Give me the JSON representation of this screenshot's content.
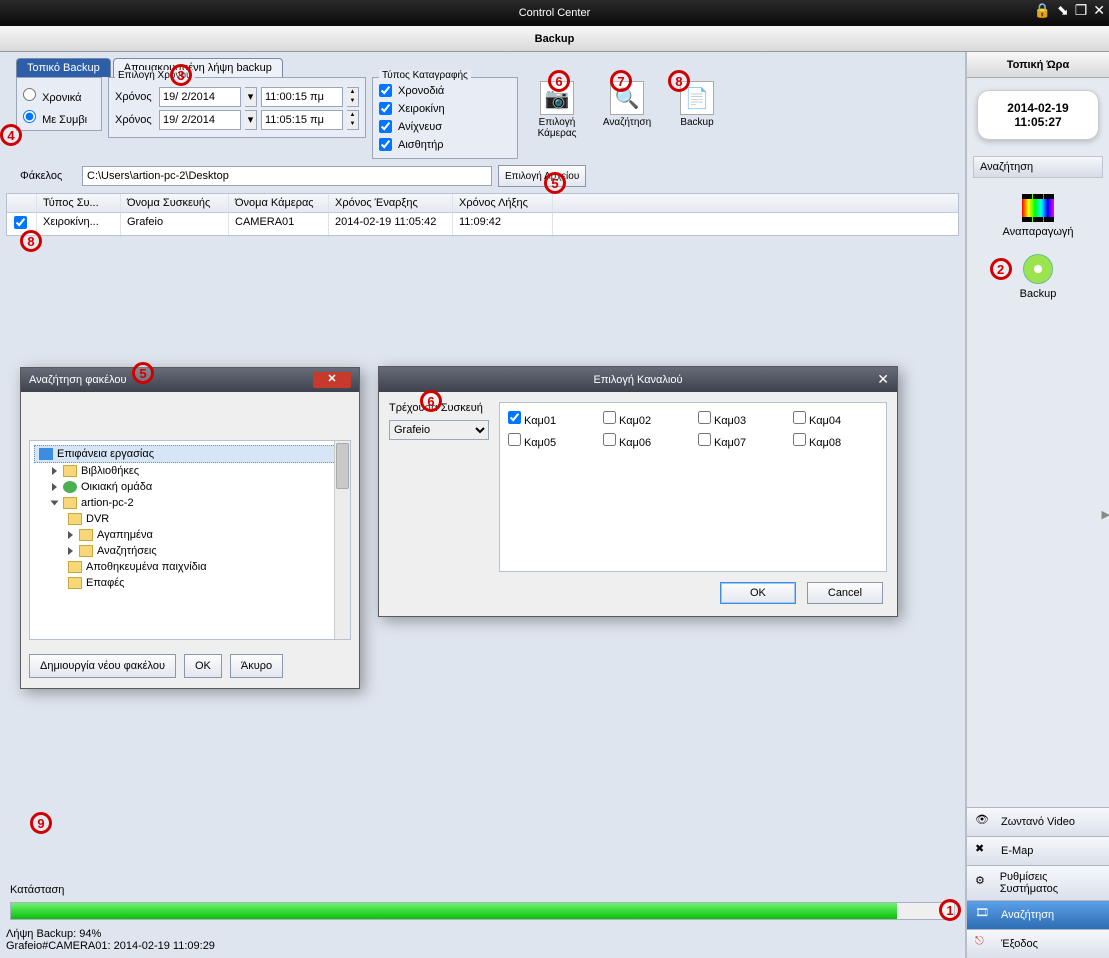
{
  "window": {
    "title": "Control Center",
    "section": "Backup"
  },
  "rightPanel": {
    "clockHeader": "Τοπική Ώρα",
    "date": "2014-02-19",
    "time": "11:05:27",
    "searchHeader": "Αναζήτηση",
    "playbackLabel": "Αναπαραγωγή",
    "backupLabel": "Backup"
  },
  "nav": {
    "live": "Ζωντανό Video",
    "emap": "E-Map",
    "settings": "Ρυθμίσεις Συστήματος",
    "search": "Αναζήτηση",
    "exit": "Έξοδος"
  },
  "tabs": {
    "local": "Τοπικό Backup",
    "remote": "Απομακρυσμένη λήψη backup"
  },
  "mode": {
    "byTime": "Χρονικά",
    "byEvent": "Με Συμβι"
  },
  "timeGroup": {
    "title": "Επιλογή Χρόνου",
    "row1Label": "Χρόνος",
    "date1": "19/ 2/2014",
    "time1": "11:00:15 πμ",
    "row2Label": "Χρόνος",
    "date2": "19/ 2/2014",
    "time2": "11:05:15 πμ"
  },
  "typeGroup": {
    "title": "Τύπος Καταγραφής",
    "c1": "Χρονοδιά",
    "c2": "Χειροκίνη",
    "c3": "Ανίχνευσ",
    "c4": "Αισθητήρ"
  },
  "bigButtons": {
    "selectCam": "Επιλογή Κάμερας",
    "search": "Αναζήτηση",
    "backup": "Backup"
  },
  "folder": {
    "label": "Φάκελος",
    "path": "C:\\Users\\artion-pc-2\\Desktop",
    "browse": "Επιλογή Αρχείου"
  },
  "grid": {
    "headers": {
      "c0": "",
      "c1": "Τύπος Συ...",
      "c2": "Όνομα Συσκευής",
      "c3": "Όνομα Κάμερας",
      "c4": "Χρόνος Έναρξης",
      "c5": "Χρόνος Λήξης"
    },
    "rows": [
      {
        "checked": true,
        "type": "Χειροκίνη...",
        "device": "Grafeio",
        "camera": "CAMERA01",
        "start": "2014-02-19 11:05:42",
        "end": "11:09:42"
      }
    ]
  },
  "folderDlg": {
    "title": "Αναζήτηση φακέλου",
    "nodes": {
      "desktop": "Επιφάνεια εργασίας",
      "libraries": "Βιβλιοθήκες",
      "homegroup": "Οικιακή ομάδα",
      "pc": "artion-pc-2",
      "dvr": "DVR",
      "fav": "Αγαπημένα",
      "searches": "Αναζητήσεις",
      "saved": "Αποθηκευμένα παιχνίδια",
      "contacts": "Επαφές"
    },
    "newFolder": "Δημιουργία νέου φακέλου",
    "ok": "OK",
    "cancel": "Άκυρο"
  },
  "channelDlg": {
    "title": "Επιλογή Καναλιού",
    "deviceLabel": "Τρέχουσα Συσκευή",
    "device": "Grafeio",
    "channels": [
      {
        "n": "Καμ01",
        "on": true
      },
      {
        "n": "Καμ02",
        "on": false
      },
      {
        "n": "Καμ03",
        "on": false
      },
      {
        "n": "Καμ04",
        "on": false
      },
      {
        "n": "Καμ05",
        "on": false
      },
      {
        "n": "Καμ06",
        "on": false
      },
      {
        "n": "Καμ07",
        "on": false
      },
      {
        "n": "Καμ08",
        "on": false
      }
    ],
    "ok": "OK",
    "cancel": "Cancel"
  },
  "status": {
    "label": "Κατάσταση",
    "line1": "Λήψη Backup: 94%",
    "line2": "Grafeio#CAMERA01: 2014-02-19 11:09:29",
    "percent": 94
  }
}
